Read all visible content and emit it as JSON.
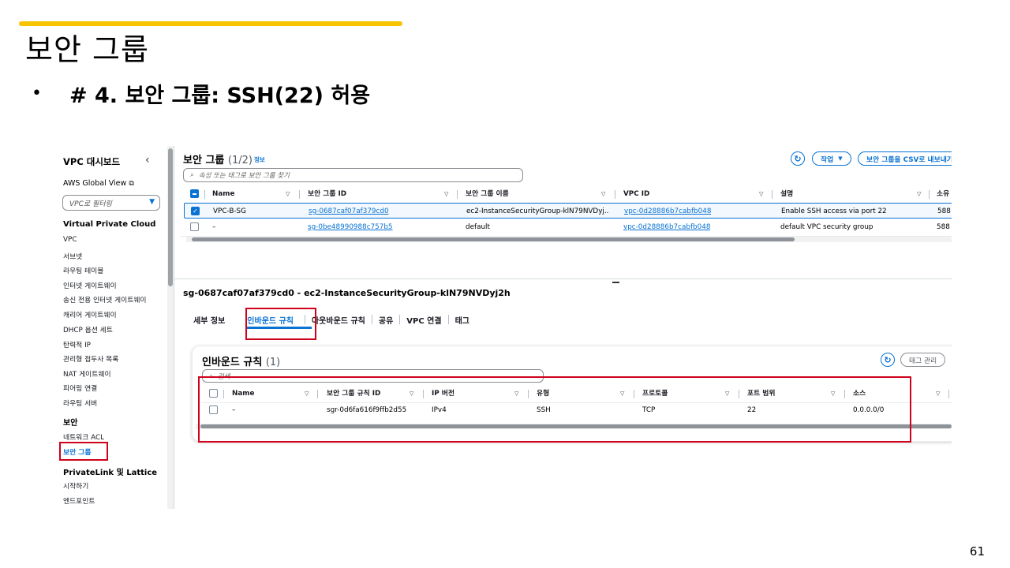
{
  "slide": {
    "title": "보안 그룹",
    "bullet": "# 4. 보안 그룹: SSH(22) 허용",
    "page_number": "61"
  },
  "colors": {
    "accent_bar": "#F7C400",
    "highlight_box": "#d0021b",
    "console_link": "#0972d3"
  },
  "sidebar": {
    "title": "VPC 대시보드",
    "global_view": "AWS Global View",
    "filter_placeholder": "VPC로 필터링",
    "section_vpc": "Virtual Private Cloud",
    "vpc_items": [
      "VPC",
      "서브넷",
      "라우팅 테이블",
      "인터넷 게이트웨이",
      "송신 전용 인터넷 게이트웨이",
      "캐리어 게이트웨이",
      "DHCP 옵션 세트",
      "탄력적 IP",
      "관리형 접두사 목록",
      "NAT 게이트웨이",
      "피어링 연결",
      "라우팅 서버"
    ],
    "section_security": "보안",
    "security_items": [
      "네트워크 ACL",
      "보안 그룹"
    ],
    "section_privatelink": "PrivateLink 및 Lattice",
    "privatelink_items": [
      "시작하기",
      "엔드포인트"
    ]
  },
  "sg_list": {
    "title": "보안 그룹",
    "count": "(1/2)",
    "info": "정보",
    "actions_label": "작업",
    "export_label": "보안 그룹을 CSV로 내보내기",
    "search_placeholder": "속성 또는 태그로 보안 그룹 찾기",
    "columns": [
      "Name",
      "보안 그룹 ID",
      "보안 그룹 이름",
      "VPC ID",
      "설명",
      "소유"
    ],
    "rows": [
      {
        "name": "VPC-B-SG",
        "id": "sg-0687caf07af379cd0",
        "group_name": "ec2-InstanceSecurityGroup-klN79NVDyj...",
        "vpc": "vpc-0d28886b7cabfb048",
        "desc": "Enable SSH access via port 22",
        "owner": "588",
        "selected": true
      },
      {
        "name": "–",
        "id": "sg-0be48990988c757b5",
        "group_name": "default",
        "vpc": "vpc-0d28886b7cabfb048",
        "desc": "default VPC security group",
        "owner": "588",
        "selected": false
      }
    ]
  },
  "detail": {
    "title": "sg-0687caf07af379cd0 - ec2-InstanceSecurityGroup-klN79NVDyj2h",
    "tabs": [
      "세부 정보",
      "인바운드 규칙",
      "아웃바운드 규칙",
      "공유",
      "VPC 연결",
      "태그"
    ],
    "active_tab": "인바운드 규칙"
  },
  "inbound": {
    "title": "인바운드 규칙",
    "count": "(1)",
    "manage_tags": "태그 관리",
    "search_placeholder": "검색",
    "columns": [
      "Name",
      "보안 그룹 규칙 ID",
      "IP 버전",
      "유형",
      "프로토콜",
      "포트 범위",
      "소스"
    ],
    "rows": [
      {
        "name": "–",
        "rule_id": "sgr-0d6fa616f9ffb2d55",
        "ip_version": "IPv4",
        "type": "SSH",
        "protocol": "TCP",
        "port_range": "22",
        "source": "0.0.0.0/0"
      }
    ]
  }
}
